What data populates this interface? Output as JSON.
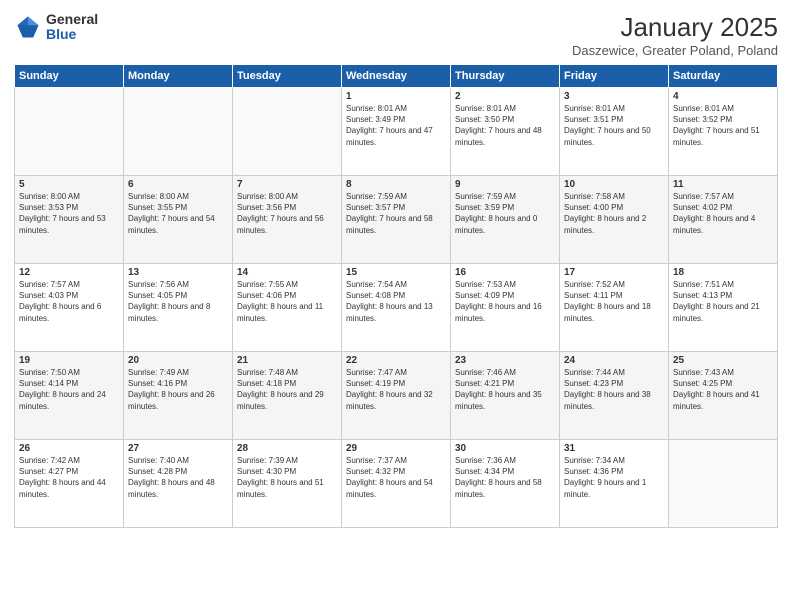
{
  "logo": {
    "general": "General",
    "blue": "Blue"
  },
  "title": "January 2025",
  "subtitle": "Daszewice, Greater Poland, Poland",
  "headers": [
    "Sunday",
    "Monday",
    "Tuesday",
    "Wednesday",
    "Thursday",
    "Friday",
    "Saturday"
  ],
  "weeks": [
    [
      {
        "day": "",
        "info": ""
      },
      {
        "day": "",
        "info": ""
      },
      {
        "day": "",
        "info": ""
      },
      {
        "day": "1",
        "info": "Sunrise: 8:01 AM\nSunset: 3:49 PM\nDaylight: 7 hours and 47 minutes."
      },
      {
        "day": "2",
        "info": "Sunrise: 8:01 AM\nSunset: 3:50 PM\nDaylight: 7 hours and 48 minutes."
      },
      {
        "day": "3",
        "info": "Sunrise: 8:01 AM\nSunset: 3:51 PM\nDaylight: 7 hours and 50 minutes."
      },
      {
        "day": "4",
        "info": "Sunrise: 8:01 AM\nSunset: 3:52 PM\nDaylight: 7 hours and 51 minutes."
      }
    ],
    [
      {
        "day": "5",
        "info": "Sunrise: 8:00 AM\nSunset: 3:53 PM\nDaylight: 7 hours and 53 minutes."
      },
      {
        "day": "6",
        "info": "Sunrise: 8:00 AM\nSunset: 3:55 PM\nDaylight: 7 hours and 54 minutes."
      },
      {
        "day": "7",
        "info": "Sunrise: 8:00 AM\nSunset: 3:56 PM\nDaylight: 7 hours and 56 minutes."
      },
      {
        "day": "8",
        "info": "Sunrise: 7:59 AM\nSunset: 3:57 PM\nDaylight: 7 hours and 58 minutes."
      },
      {
        "day": "9",
        "info": "Sunrise: 7:59 AM\nSunset: 3:59 PM\nDaylight: 8 hours and 0 minutes."
      },
      {
        "day": "10",
        "info": "Sunrise: 7:58 AM\nSunset: 4:00 PM\nDaylight: 8 hours and 2 minutes."
      },
      {
        "day": "11",
        "info": "Sunrise: 7:57 AM\nSunset: 4:02 PM\nDaylight: 8 hours and 4 minutes."
      }
    ],
    [
      {
        "day": "12",
        "info": "Sunrise: 7:57 AM\nSunset: 4:03 PM\nDaylight: 8 hours and 6 minutes."
      },
      {
        "day": "13",
        "info": "Sunrise: 7:56 AM\nSunset: 4:05 PM\nDaylight: 8 hours and 8 minutes."
      },
      {
        "day": "14",
        "info": "Sunrise: 7:55 AM\nSunset: 4:06 PM\nDaylight: 8 hours and 11 minutes."
      },
      {
        "day": "15",
        "info": "Sunrise: 7:54 AM\nSunset: 4:08 PM\nDaylight: 8 hours and 13 minutes."
      },
      {
        "day": "16",
        "info": "Sunrise: 7:53 AM\nSunset: 4:09 PM\nDaylight: 8 hours and 16 minutes."
      },
      {
        "day": "17",
        "info": "Sunrise: 7:52 AM\nSunset: 4:11 PM\nDaylight: 8 hours and 18 minutes."
      },
      {
        "day": "18",
        "info": "Sunrise: 7:51 AM\nSunset: 4:13 PM\nDaylight: 8 hours and 21 minutes."
      }
    ],
    [
      {
        "day": "19",
        "info": "Sunrise: 7:50 AM\nSunset: 4:14 PM\nDaylight: 8 hours and 24 minutes."
      },
      {
        "day": "20",
        "info": "Sunrise: 7:49 AM\nSunset: 4:16 PM\nDaylight: 8 hours and 26 minutes."
      },
      {
        "day": "21",
        "info": "Sunrise: 7:48 AM\nSunset: 4:18 PM\nDaylight: 8 hours and 29 minutes."
      },
      {
        "day": "22",
        "info": "Sunrise: 7:47 AM\nSunset: 4:19 PM\nDaylight: 8 hours and 32 minutes."
      },
      {
        "day": "23",
        "info": "Sunrise: 7:46 AM\nSunset: 4:21 PM\nDaylight: 8 hours and 35 minutes."
      },
      {
        "day": "24",
        "info": "Sunrise: 7:44 AM\nSunset: 4:23 PM\nDaylight: 8 hours and 38 minutes."
      },
      {
        "day": "25",
        "info": "Sunrise: 7:43 AM\nSunset: 4:25 PM\nDaylight: 8 hours and 41 minutes."
      }
    ],
    [
      {
        "day": "26",
        "info": "Sunrise: 7:42 AM\nSunset: 4:27 PM\nDaylight: 8 hours and 44 minutes."
      },
      {
        "day": "27",
        "info": "Sunrise: 7:40 AM\nSunset: 4:28 PM\nDaylight: 8 hours and 48 minutes."
      },
      {
        "day": "28",
        "info": "Sunrise: 7:39 AM\nSunset: 4:30 PM\nDaylight: 8 hours and 51 minutes."
      },
      {
        "day": "29",
        "info": "Sunrise: 7:37 AM\nSunset: 4:32 PM\nDaylight: 8 hours and 54 minutes."
      },
      {
        "day": "30",
        "info": "Sunrise: 7:36 AM\nSunset: 4:34 PM\nDaylight: 8 hours and 58 minutes."
      },
      {
        "day": "31",
        "info": "Sunrise: 7:34 AM\nSunset: 4:36 PM\nDaylight: 9 hours and 1 minute."
      },
      {
        "day": "",
        "info": ""
      }
    ]
  ]
}
